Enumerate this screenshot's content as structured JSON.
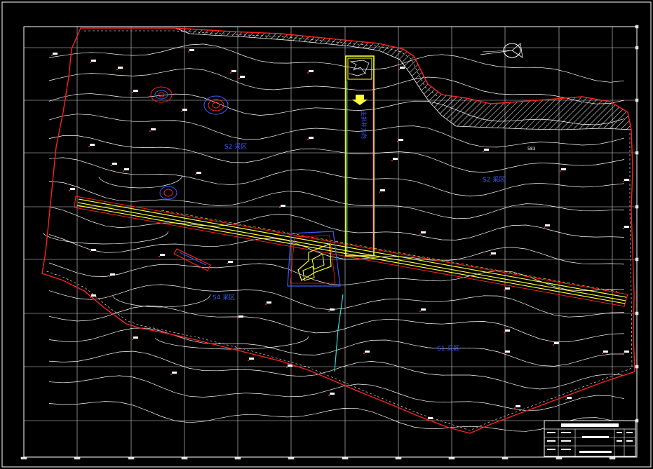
{
  "drawing": {
    "background": "#000000",
    "colors": {
      "frame": "#ffffff",
      "grid": "#ffffff",
      "contour": "#ffffff",
      "boundary": "#ff2020",
      "corridor": "#ffff33",
      "zone_text": "#3a5cff",
      "pipe": "#33dddd",
      "hatch": "#ffffff"
    }
  },
  "zones": [
    {
      "id": "z1",
      "label": "S2 采区"
    },
    {
      "id": "z2",
      "label": "S2 采区"
    },
    {
      "id": "z3",
      "label": "S4 采区"
    },
    {
      "id": "z4",
      "label": "S1 采区"
    }
  ],
  "shaft_label": "主斜井方向",
  "point_note": "583",
  "title_block": {
    "rows": [
      {
        "left": "",
        "mid": "",
        "right": ""
      },
      {
        "left": "",
        "mid": "",
        "right": ""
      },
      {
        "left": "",
        "mid": "",
        "right": ""
      },
      {
        "left": "",
        "mid": "",
        "right": ""
      }
    ]
  },
  "icons": [
    "north-arrow-icon",
    "direction-arrow-icon"
  ]
}
